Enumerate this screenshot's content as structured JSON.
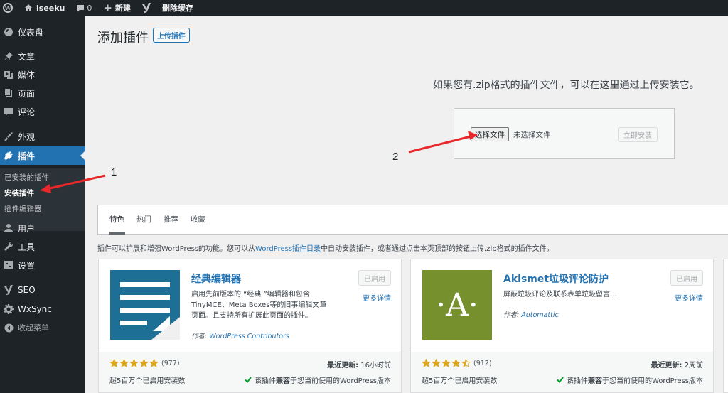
{
  "adminbar": {
    "site_name": "iseeku",
    "comment_count": "0",
    "new_label": "新建",
    "clear_cache_label": "删除缓存"
  },
  "sidebar": {
    "items": [
      {
        "label": "仪表盘",
        "icon": "dashboard-icon"
      },
      {
        "label": "文章",
        "icon": "pin-icon"
      },
      {
        "label": "媒体",
        "icon": "media-icon"
      },
      {
        "label": "页面",
        "icon": "page-icon"
      },
      {
        "label": "评论",
        "icon": "comment-icon"
      },
      {
        "label": "外观",
        "icon": "brush-icon"
      },
      {
        "label": "插件",
        "icon": "plugin-icon"
      },
      {
        "label": "用户",
        "icon": "user-icon"
      },
      {
        "label": "工具",
        "icon": "wrench-icon"
      },
      {
        "label": "设置",
        "icon": "settings-icon"
      },
      {
        "label": "SEO",
        "icon": "seo-icon"
      },
      {
        "label": "WxSync",
        "icon": "gear-icon"
      }
    ],
    "submenu": [
      "已安装的插件",
      "安装插件",
      "插件编辑器"
    ],
    "collapse_label": "收起菜单"
  },
  "page": {
    "title": "添加插件",
    "upload_button": "上传插件",
    "upload_help": "如果您有.zip格式的插件文件，可以在这里通过上传安装它。",
    "choose_file": "选择文件",
    "no_file": "未选择文件",
    "install_now": "立即安装"
  },
  "tabs": [
    "特色",
    "热门",
    "推荐",
    "收藏"
  ],
  "intro": {
    "before": "插件可以扩展和增强WordPress的功能。您可以从",
    "link": "WordPress插件目录",
    "after": "中自动安装插件，或者通过点击本页顶部的按钮上传.zip格式的插件文件。"
  },
  "plugins": [
    {
      "name": "经典编辑器",
      "description": "启用先前版本的 “经典 ”编辑器和包含TinyMCE、Meta Boxes等的旧事编辑文章页面。且支持所有扩展此页面的插件。",
      "author_label": "作者: ",
      "author": "WordPress Contributors",
      "status": "已启用",
      "more": "更多详情",
      "rating": 5,
      "rating_count": "(977)",
      "installs": "超5百万个已启用安装数",
      "updated_label": "最近更新:",
      "updated": "16小时前",
      "compat_pre": "该插件",
      "compat_bold": "兼容",
      "compat_post": "于您当前使用的WordPress版本",
      "icon_color": "#1d6f96"
    },
    {
      "name": "Akismet垃圾评论防护",
      "description": "屏蔽垃圾评论及联系表单垃圾留言…",
      "author_label": "作者: ",
      "author": "Automattic",
      "status": "已启用",
      "more": "更多详情",
      "rating": 4.5,
      "rating_count": "(912)",
      "installs": "超5百万个已启用安装数",
      "updated_label": "最近更新:",
      "updated": "2周前",
      "compat_pre": "该插件",
      "compat_bold": "兼容",
      "compat_post": "于您当前使用的WordPress版本",
      "icon_color": "#77902e",
      "icon_letter": "·A·"
    }
  ],
  "annotations": {
    "label_1": "1",
    "label_2": "2",
    "arrow_color": "#e8282b"
  },
  "colors": {
    "accent": "#2271b1",
    "menu_bg": "#1d2327",
    "star": "#dba617"
  }
}
